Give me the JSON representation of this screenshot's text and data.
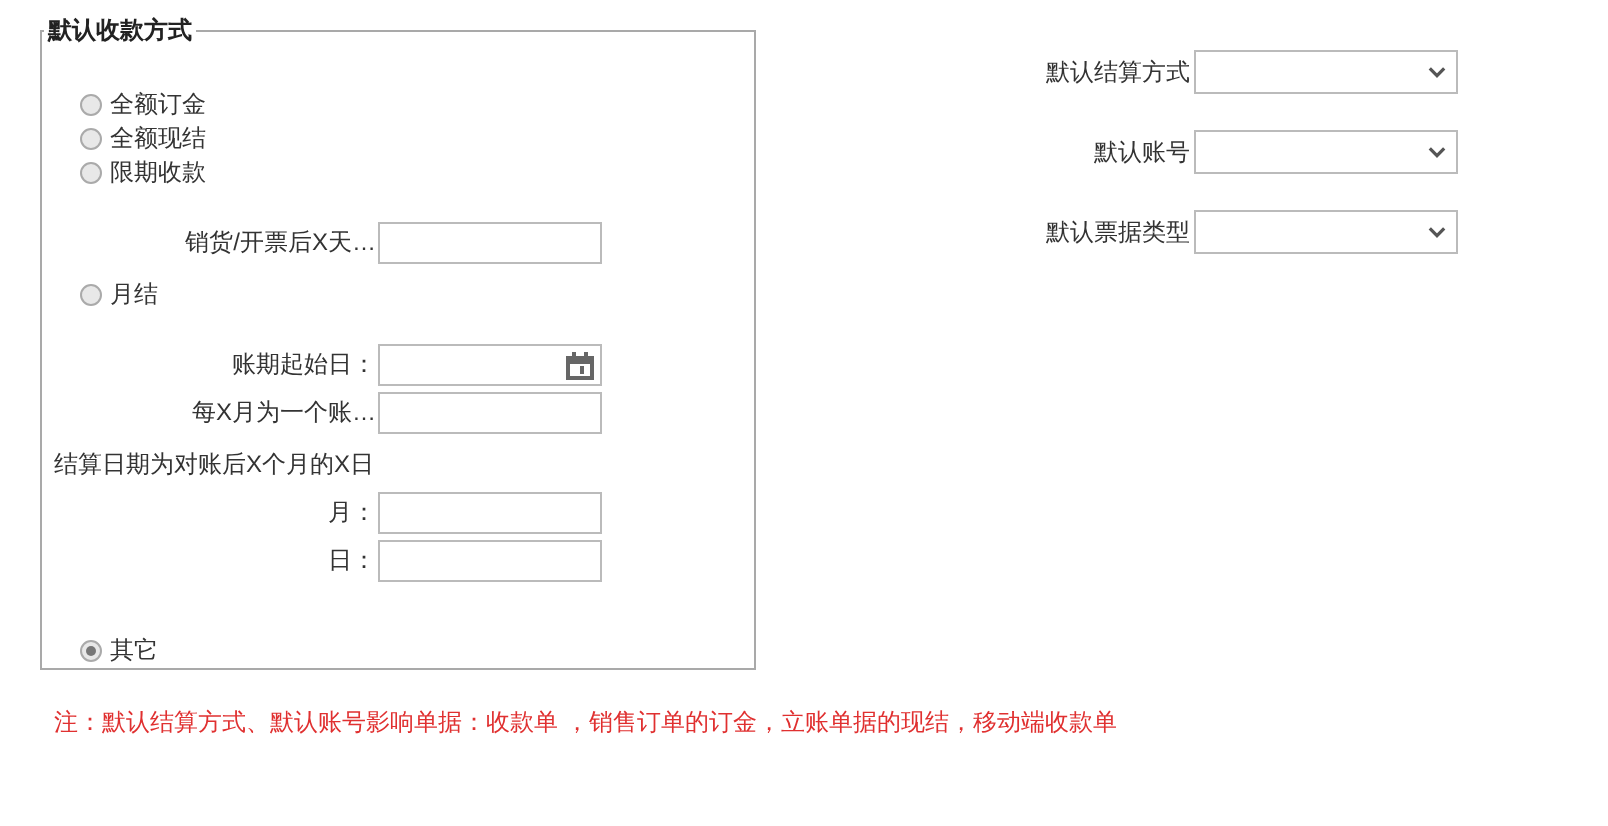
{
  "payment_group": {
    "title": "默认收款方式",
    "items": [
      {
        "kind": "radio",
        "label": "全额订金",
        "selected": false
      },
      {
        "kind": "radio",
        "label": "全额现结",
        "selected": false
      },
      {
        "kind": "radio",
        "label": "限期收款",
        "selected": false
      },
      {
        "kind": "field",
        "label": "销货/开票后X天…"
      },
      {
        "kind": "radio",
        "label": "月结",
        "selected": false
      },
      {
        "kind": "date",
        "label": "账期起始日："
      },
      {
        "kind": "field",
        "label": "每X月为一个账…"
      },
      {
        "kind": "text",
        "label": "结算日期为对账后X个月的X日"
      },
      {
        "kind": "field",
        "label": "月："
      },
      {
        "kind": "field",
        "label": "日："
      },
      {
        "kind": "radio",
        "label": "其它",
        "selected": true
      }
    ]
  },
  "defaults": [
    {
      "label": "默认结算方式"
    },
    {
      "label": "默认账号"
    },
    {
      "label": "默认票据类型"
    }
  ],
  "note": "注：默认结算方式、默认账号影响单据：收款单 ，销售订单的订金，立账单据的现结，移动端收款单"
}
